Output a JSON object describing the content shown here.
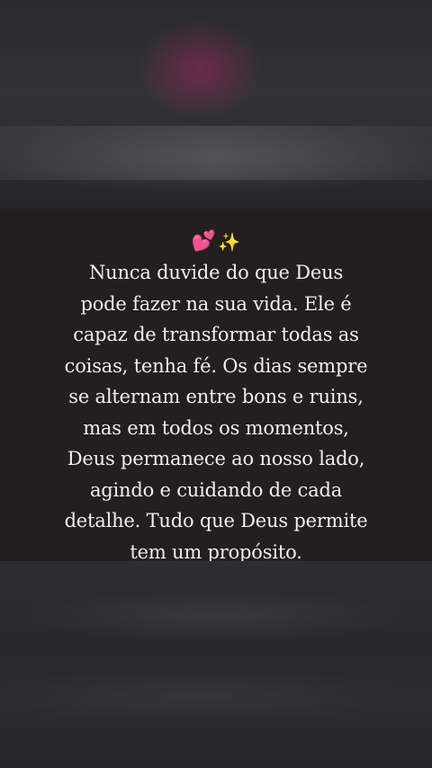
{
  "post": {
    "emojis": {
      "hearts": "💕",
      "sparkles": "✨"
    },
    "quote_lines": [
      "Nunca duvide do que Deus",
      "pode fazer na sua vida. Ele é",
      "capaz de transformar todas as",
      "coisas, tenha fé. Os dias sempre",
      "se alternam entre bons e ruins,",
      "mas em todos os momentos,",
      "Deus permanece ao nosso lado,",
      "agindo e cuidando de cada",
      "detalhe. Tudo que Deus permite",
      "tem um propósito."
    ]
  },
  "colors": {
    "card_background": "#231f20",
    "text": "#f3eeea",
    "blurred_background": "#2c2c2f"
  }
}
